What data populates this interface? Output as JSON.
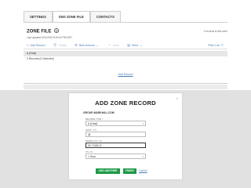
{
  "tabs": [
    {
      "label": "SETTINGS"
    },
    {
      "label": "DNS ZONE FILE"
    },
    {
      "label": "CONTACTS"
    }
  ],
  "zone": {
    "title": "ZONE FILE",
    "help_icon": "?",
    "updated": "Last updated 3/11/2013 8:00:03 PM MST",
    "record_count": "4 records in this zone"
  },
  "toolbar": {
    "add_record": "Add Record",
    "delete": "Delete",
    "bulk_actions": "Bulk Actions",
    "undo": "Undo",
    "more": "More",
    "filter": "Filter List"
  },
  "group": {
    "header": "A (Host)",
    "subtext": "0 Records (0 Selected)"
  },
  "add_record_link": "Add Record",
  "modal": {
    "title": "ADD ZONE RECORD",
    "close": "x",
    "domain": "GROUP-MARKHAL.COM",
    "record_type_label": "RECORD TYPE *",
    "record_type_value": "A (Host)",
    "host_label": "HOST * (?)",
    "host_value": "@",
    "points_to_label": "POINTS TO * (?)",
    "points_to_value": "50.73.88.21",
    "ttl_label": "TTL (?)",
    "ttl_value": "1 Hour",
    "add_another": "ADD ANOTHER",
    "finish": "FINISH",
    "cancel": "Cancel"
  }
}
